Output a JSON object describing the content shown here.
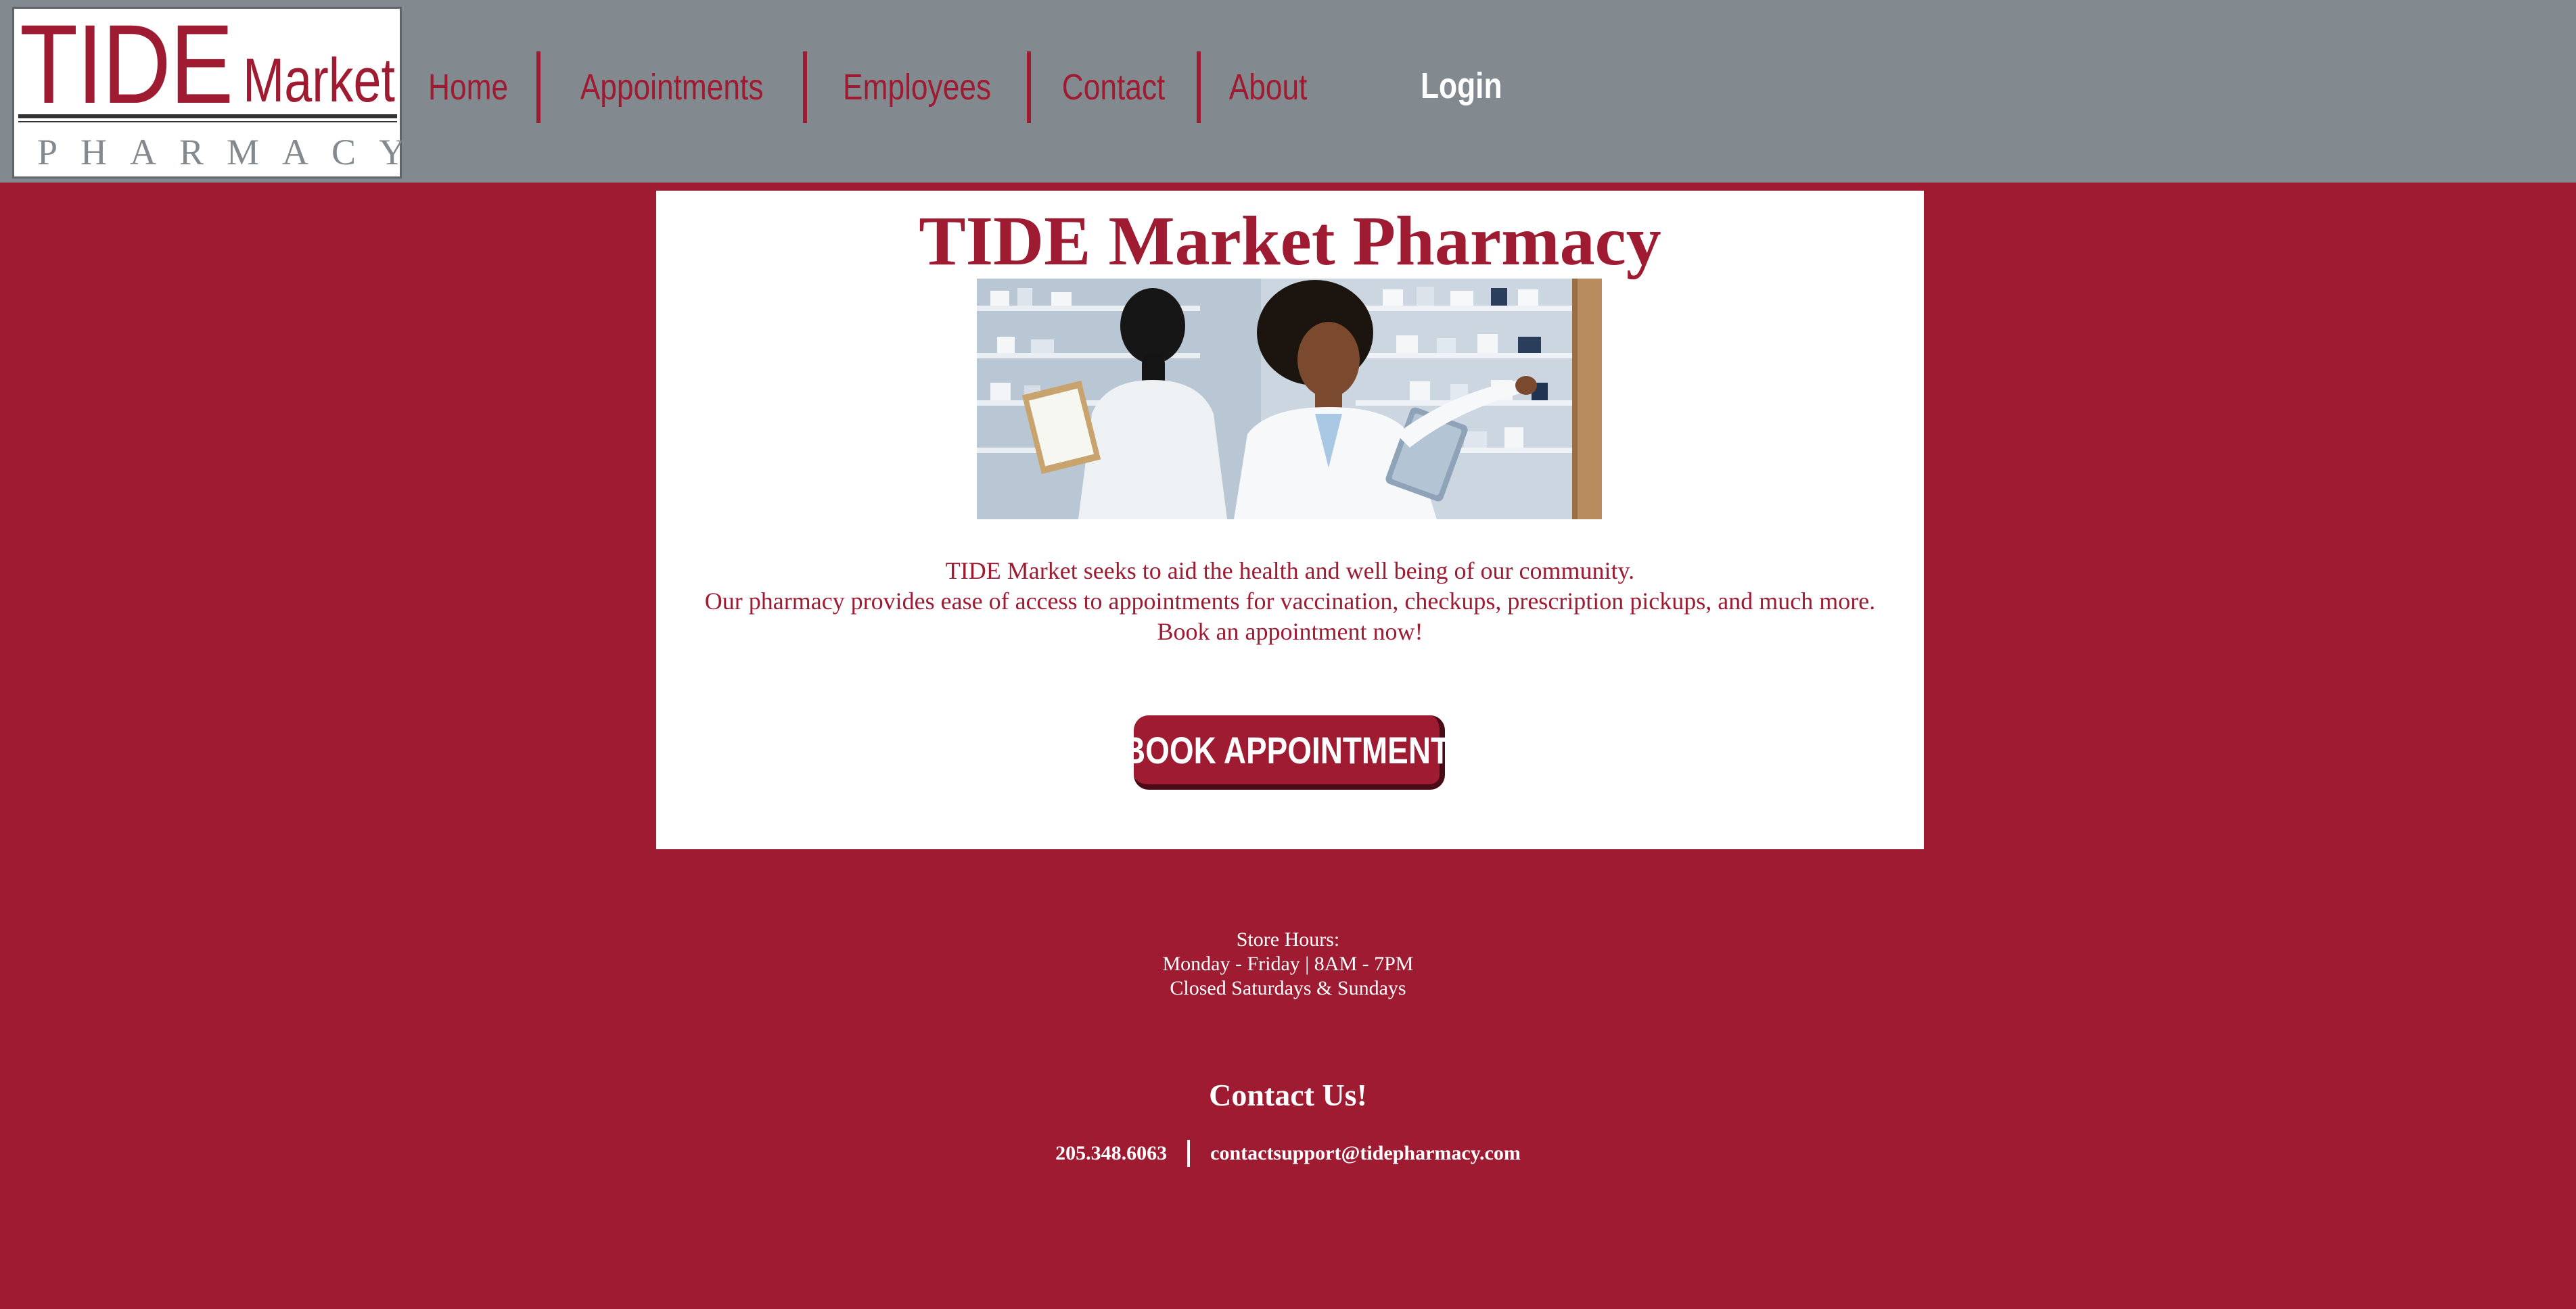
{
  "header": {
    "logo": {
      "word_tide": "TIDE",
      "word_market": "Market",
      "word_pharmacy": "PHARMACY"
    },
    "nav": [
      {
        "label": "Home"
      },
      {
        "label": "Appointments"
      },
      {
        "label": "Employees"
      },
      {
        "label": "Contact"
      },
      {
        "label": "About"
      }
    ],
    "login_label": "Login"
  },
  "main": {
    "title": "TIDE Market Pharmacy",
    "intro_lines": [
      "TIDE Market seeks to aid the health and well being of our community.",
      "Our pharmacy provides ease of access to appointments for vaccination, checkups, prescription pickups, and much more.",
      "Book an appointment now!"
    ],
    "book_button_label": "BOOK APPOINTMENT"
  },
  "footer": {
    "hours": [
      "Store Hours:",
      "Monday - Friday | 8AM - 7PM",
      "Closed Saturdays & Sundays"
    ],
    "contact_title": "Contact Us!",
    "phone": "205.348.6063",
    "email": "contactsupport@tidepharmacy.com"
  },
  "colors": {
    "brand_crimson": "#9e1b32",
    "header_gray": "#828a8f",
    "card_white": "#ffffff",
    "button_shadow": "#4a0a16"
  }
}
